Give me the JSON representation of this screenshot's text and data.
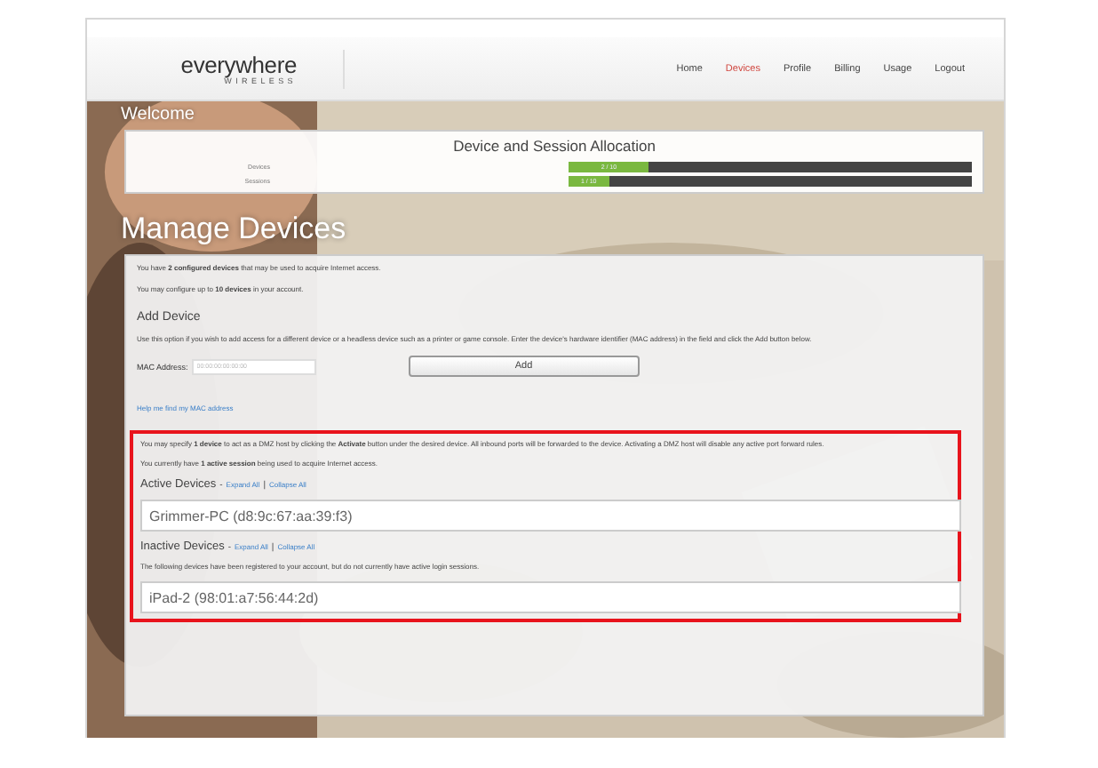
{
  "header": {
    "logo": {
      "brand": "everywhere",
      "tagline": "WIRELESS"
    },
    "nav": [
      {
        "label": "Home",
        "selected": false
      },
      {
        "label": "Devices",
        "selected": true
      },
      {
        "label": "Profile",
        "selected": false
      },
      {
        "label": "Billing",
        "selected": false
      },
      {
        "label": "Usage",
        "selected": false
      },
      {
        "label": "Logout",
        "selected": false
      }
    ]
  },
  "welcome": "Welcome",
  "allocation": {
    "title": "Device and Session Allocation",
    "rows": [
      {
        "label": "Devices",
        "reading": "2 / 10",
        "level": 0.2
      },
      {
        "label": "Sessions",
        "reading": "1 / 10",
        "level": 0.1
      }
    ]
  },
  "heading": "Manage Devices",
  "intro": [
    "You have **2 configured devices** that may be used to acquire Internet access.",
    "You may configure up to **10 devices** in your account."
  ],
  "add_device": {
    "title": "Add Device",
    "description": "Use this option if you wish to add access for a different device or a headless device such as a printer or game console. Enter the device's hardware identifier (MAC address) in the field and click the Add button below.",
    "field_label": "MAC Address:",
    "placeholder": "00:00:00:00:00:00",
    "button": "Add",
    "help_link": "Help me find my MAC address"
  },
  "dmz": {
    "highlighted": true,
    "notes": [
      "You may specify **1 device** to act as a DMZ host by clicking the **Activate** button under the desired device. All inbound ports will be forwarded to the device. Activating a DMZ host will disable any active port forward rules.",
      "You currently have **1 active session** being used to acquire Internet access."
    ],
    "groups": [
      {
        "title": "Active Devices",
        "separator": "-",
        "expand": "Expand All",
        "divider": "|",
        "collapse": "Collapse All",
        "devices": [
          "Grimmer-PC (d8:9c:67:aa:39:f3)"
        ]
      },
      {
        "title": "Inactive Devices",
        "separator": "-",
        "expand": "Expand All",
        "divider": "|",
        "collapse": "Collapse All",
        "note": "The following devices have been registered to your account, but do not currently have active login sessions.",
        "devices": [
          "iPad-2 (98:01:a7:56:44:2d)"
        ]
      }
    ]
  }
}
